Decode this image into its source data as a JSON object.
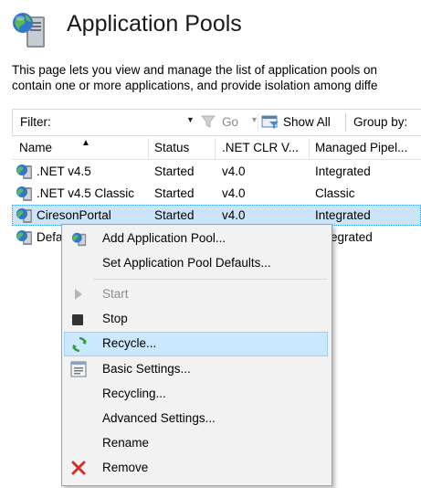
{
  "page": {
    "title": "Application Pools",
    "description_line1": "This page lets you view and manage the list of application pools on",
    "description_line2": "contain one or more applications, and provide isolation among diffe"
  },
  "toolbar": {
    "filter_label": "Filter:",
    "filter_value": "",
    "go_label": "Go",
    "show_all_label": "Show All",
    "group_by_label": "Group by:"
  },
  "table": {
    "columns": [
      "Name",
      "Status",
      ".NET CLR V...",
      "Managed Pipel..."
    ],
    "rows": [
      {
        "name": ".NET v4.5",
        "status": "Started",
        "clr": "v4.0",
        "pipeline": "Integrated"
      },
      {
        "name": ".NET v4.5 Classic",
        "status": "Started",
        "clr": "v4.0",
        "pipeline": "Classic"
      },
      {
        "name": "CiresonPortal",
        "status": "Started",
        "clr": "v4.0",
        "pipeline": "Integrated"
      },
      {
        "name": "Defa",
        "status": "",
        "clr": "",
        "pipeline": "egrated"
      }
    ],
    "selected_row": "CiresonPortal"
  },
  "context_menu": {
    "items": [
      {
        "label": "Add Application Pool...",
        "icon": "app-pool-icon"
      },
      {
        "label": "Set Application Pool Defaults...",
        "icon": ""
      },
      {
        "label": "Start",
        "icon": "play-icon",
        "disabled": true
      },
      {
        "label": "Stop",
        "icon": "stop-icon"
      },
      {
        "label": "Recycle...",
        "icon": "recycle-icon",
        "hover": true
      },
      {
        "label": "Basic Settings...",
        "icon": "settings-icon"
      },
      {
        "label": "Recycling...",
        "icon": ""
      },
      {
        "label": "Advanced Settings...",
        "icon": ""
      },
      {
        "label": "Rename",
        "icon": ""
      },
      {
        "label": "Remove",
        "icon": "remove-icon"
      }
    ]
  },
  "colors": {
    "selection": "#cce4f7",
    "menu_hover": "#cce8ff",
    "remove_red": "#d32f2f",
    "recycle_green": "#2e9e3e"
  }
}
